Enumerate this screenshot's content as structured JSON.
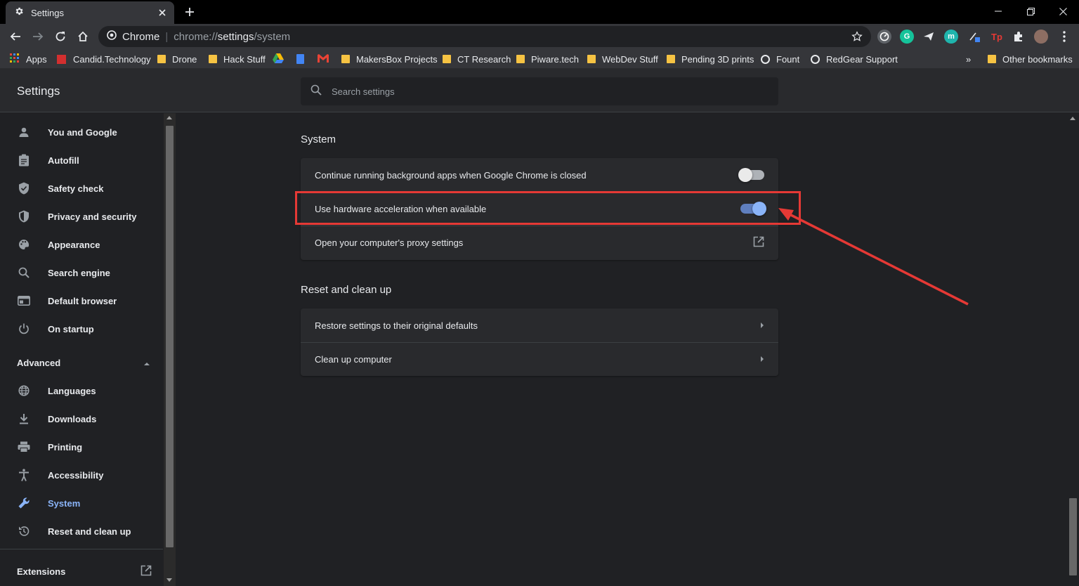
{
  "browser": {
    "tab_title": "Settings",
    "address_site": "Chrome",
    "address_url_prefix": "chrome://",
    "address_url_main": "settings",
    "address_url_suffix": "/system"
  },
  "bookmarks": [
    {
      "label": "Apps",
      "icon": "apps-grid-icon"
    },
    {
      "label": "Candid.Technology",
      "icon": "candid-icon"
    },
    {
      "label": "Drone",
      "icon": "folder-icon"
    },
    {
      "label": "Hack Stuff",
      "icon": "folder-icon"
    },
    {
      "label": "",
      "icon": "google-drive-icon"
    },
    {
      "label": "",
      "icon": "google-docs-icon"
    },
    {
      "label": "",
      "icon": "gmail-icon"
    },
    {
      "label": "MakersBox Projects",
      "icon": "folder-icon"
    },
    {
      "label": "CT Research",
      "icon": "folder-icon"
    },
    {
      "label": "Piware.tech",
      "icon": "folder-icon"
    },
    {
      "label": "WebDev Stuff",
      "icon": "folder-icon"
    },
    {
      "label": "Pending 3D prints",
      "icon": "folder-icon"
    },
    {
      "label": "Fount",
      "icon": "globe-icon"
    },
    {
      "label": "RedGear Support",
      "icon": "globe-icon"
    }
  ],
  "bookmarks_overflow": "»",
  "other_bookmarks": "Other bookmarks",
  "settings": {
    "title": "Settings",
    "search_placeholder": "Search settings"
  },
  "sidebar": {
    "items": [
      {
        "label": "You and Google",
        "icon": "person-icon"
      },
      {
        "label": "Autofill",
        "icon": "clipboard-icon"
      },
      {
        "label": "Safety check",
        "icon": "shield-check-icon"
      },
      {
        "label": "Privacy and security",
        "icon": "shield-icon"
      },
      {
        "label": "Appearance",
        "icon": "palette-icon"
      },
      {
        "label": "Search engine",
        "icon": "search-icon"
      },
      {
        "label": "Default browser",
        "icon": "browser-icon"
      },
      {
        "label": "On startup",
        "icon": "power-icon"
      }
    ],
    "advanced_label": "Advanced",
    "advanced_items": [
      {
        "label": "Languages",
        "icon": "globe-icon"
      },
      {
        "label": "Downloads",
        "icon": "download-icon"
      },
      {
        "label": "Printing",
        "icon": "printer-icon"
      },
      {
        "label": "Accessibility",
        "icon": "accessibility-icon"
      },
      {
        "label": "System",
        "icon": "wrench-icon",
        "active": true
      },
      {
        "label": "Reset and clean up",
        "icon": "restore-icon"
      }
    ],
    "extensions_label": "Extensions"
  },
  "system_section": {
    "title": "System",
    "rows": [
      {
        "label": "Continue running background apps when Google Chrome is closed",
        "control": "toggle",
        "state": false
      },
      {
        "label": "Use hardware acceleration when available",
        "control": "toggle",
        "state": true
      },
      {
        "label": "Open your computer's proxy settings",
        "control": "external-link"
      }
    ]
  },
  "reset_section": {
    "title": "Reset and clean up",
    "rows": [
      {
        "label": "Restore settings to their original defaults",
        "control": "chevron"
      },
      {
        "label": "Clean up computer",
        "control": "chevron"
      }
    ]
  },
  "colors": {
    "accent": "#8ab4f8",
    "annotation": "#e53935",
    "background": "#202124",
    "card": "#292a2d"
  }
}
